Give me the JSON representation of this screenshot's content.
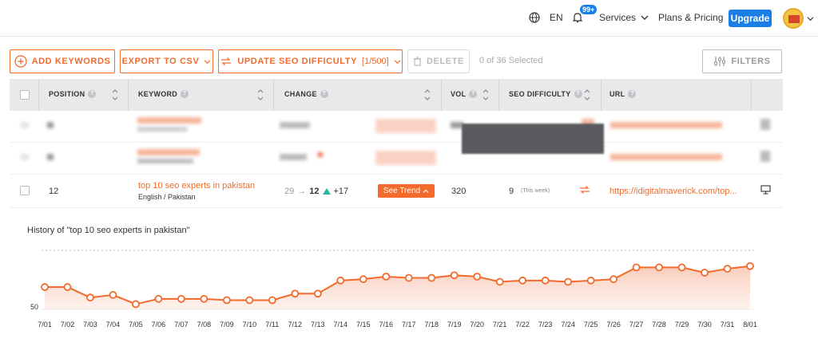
{
  "topbar": {
    "language": "EN",
    "notif_badge": "99+",
    "services": "Services",
    "plans": "Plans & Pricing",
    "upgrade": "Upgrade"
  },
  "toolbar": {
    "add_keywords": "ADD KEYWORDS",
    "export_csv": "EXPORT TO CSV",
    "update_seo": "UPDATE SEO DIFFICULTY",
    "update_seo_count": "[1/500]",
    "delete": "DELETE",
    "selected": "0 of 36 Selected",
    "filters": "FILTERS"
  },
  "table": {
    "headers": [
      "POSITION",
      "KEYWORD",
      "CHANGE",
      "VOL",
      "SEO DIFFICULTY",
      "URL"
    ],
    "row": {
      "position": "12",
      "keyword": "top 10 seo experts in pakistan",
      "sub": "English / Pakistan",
      "change_from": "29",
      "change_arrow": "→",
      "change_to": "12",
      "change_delta": "+17",
      "see_trend": "See Trend",
      "vol": "320",
      "seo_difficulty": "9",
      "seo_note": "(This week)",
      "url": "https://idigitalmaverick.com/top..."
    }
  },
  "colors": {
    "accent": "#f26b2c",
    "primary": "#1a7ee6",
    "up": "#2bb5a0"
  },
  "chart_data": {
    "type": "area",
    "title": "History of \"top 10 seo experts in pakistan\"",
    "x": [
      "7/01",
      "7/02",
      "7/03",
      "7/04",
      "7/05",
      "7/06",
      "7/07",
      "7/08",
      "7/09",
      "7/10",
      "7/11",
      "7/12",
      "7/13",
      "7/14",
      "7/15",
      "7/16",
      "7/17",
      "7/18",
      "7/19",
      "7/20",
      "7/21",
      "7/22",
      "7/23",
      "7/24",
      "7/25",
      "7/26",
      "7/27",
      "7/28",
      "7/29",
      "7/30",
      "7/31",
      "8/01"
    ],
    "y_label_tick": "50",
    "series": [
      {
        "values": [
          62,
          62,
          54,
          56,
          49,
          53,
          53,
          53,
          52,
          52,
          52,
          57,
          57,
          67,
          68,
          70,
          69,
          69,
          71,
          70,
          66,
          67,
          67,
          66,
          67,
          68,
          77,
          77,
          77,
          73,
          76,
          78
        ]
      }
    ],
    "ylim": [
      45,
      90
    ],
    "grid": "dotted top line"
  }
}
